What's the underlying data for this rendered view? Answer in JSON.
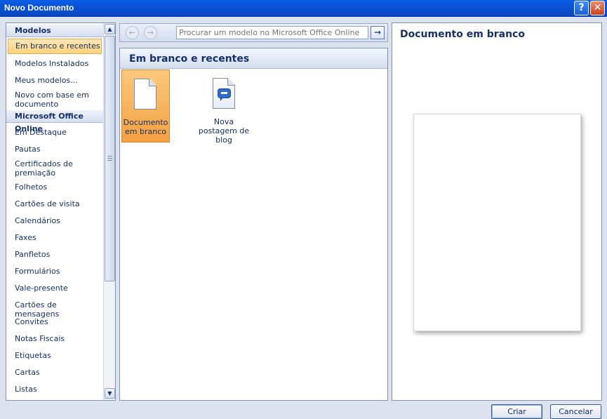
{
  "window": {
    "title": "Novo Documento",
    "help_icon": "help-icon",
    "close_icon": "close-icon",
    "help_glyph": "?",
    "close_glyph": "✕"
  },
  "sidebar": {
    "section1": "Modelos",
    "items1": [
      "Em branco e recentes",
      "Modelos Instalados",
      "Meus modelos...",
      "Novo com base em documento existente..."
    ],
    "section2": "Microsoft Office Online",
    "items2": [
      "Em Destaque",
      "Pautas",
      "Certificados de premiação",
      "Folhetos",
      "Cartões de visita",
      "Calendários",
      "Faxes",
      "Panfletos",
      "Formulários",
      "Vale-presente",
      "Cartões de mensagens",
      "Convites",
      "Notas Fiscais",
      "Etiquetas",
      "Cartas",
      "Listas"
    ],
    "selected": "Em branco e recentes"
  },
  "toolbar": {
    "back_glyph": "←",
    "forward_glyph": "→",
    "search_placeholder": "Procurar um modelo no Microsoft Office Online",
    "go_glyph": "→"
  },
  "main": {
    "heading": "Em branco e recentes",
    "templates": [
      {
        "label": "Documento em branco",
        "icon": "blank-document-icon",
        "selected": true
      },
      {
        "label": "Nova postagem de blog",
        "icon": "blog-post-icon",
        "selected": false
      }
    ]
  },
  "preview": {
    "title": "Documento em branco"
  },
  "buttons": {
    "create": "Criar",
    "cancel": "Cancelar"
  },
  "colors": {
    "accent": "#15306a",
    "titlebar": "#0b52d6",
    "selection": "#f4a140"
  }
}
